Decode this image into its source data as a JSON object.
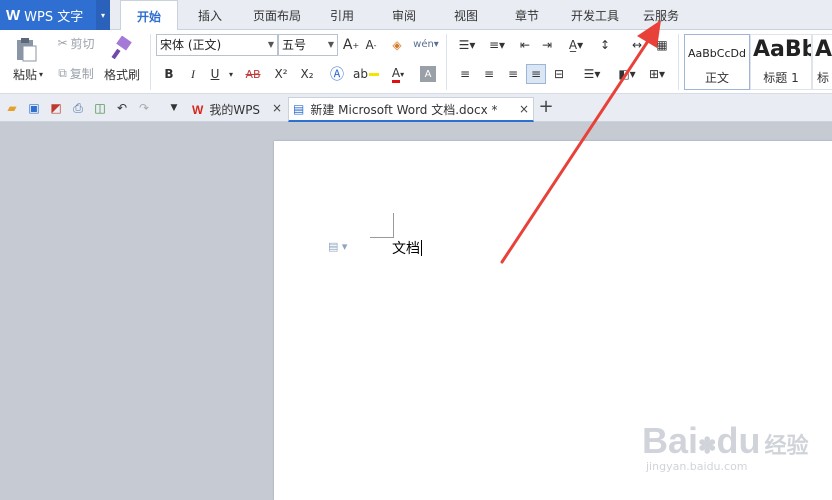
{
  "app": {
    "logo": "W",
    "name": "WPS 文字",
    "caret": "▾"
  },
  "menu_tabs": [
    {
      "label": "开始",
      "active": true
    },
    {
      "label": "插入"
    },
    {
      "label": "页面布局"
    },
    {
      "label": "引用"
    },
    {
      "label": "审阅"
    },
    {
      "label": "视图"
    },
    {
      "label": "章节"
    },
    {
      "label": "开发工具"
    },
    {
      "label": "云服务"
    }
  ],
  "ribbon": {
    "paste": "粘贴",
    "cut": "剪切",
    "copy": "复制",
    "format_painter": "格式刷",
    "font_name": "宋体 (正文)",
    "font_size": "五号",
    "bold": "B",
    "italic": "I",
    "underline": "U",
    "strike": "AB",
    "superscript": "X²",
    "subscript": "X₂",
    "grow_font": "A",
    "shrink_font": "A",
    "font_color": "A",
    "styles": [
      {
        "preview": "AaBbCcDd",
        "name": "正文"
      },
      {
        "preview": "AaBb",
        "name": "标题 1"
      },
      {
        "preview": "A",
        "name": "标"
      }
    ]
  },
  "doc_tabs": [
    {
      "label": "我的WPS",
      "icon": "wps-logo-icon"
    },
    {
      "label": "新建 Microsoft Word 文档.docx *",
      "icon": "document-icon",
      "active": true
    }
  ],
  "document": {
    "text": "文档"
  },
  "watermark": {
    "brand": "Bai",
    "brand2": "du",
    "cn": "经验",
    "url": "jingyan.baidu.com"
  },
  "colors": {
    "accent": "#2f6fd1",
    "annotation_arrow": "#e8413a"
  }
}
